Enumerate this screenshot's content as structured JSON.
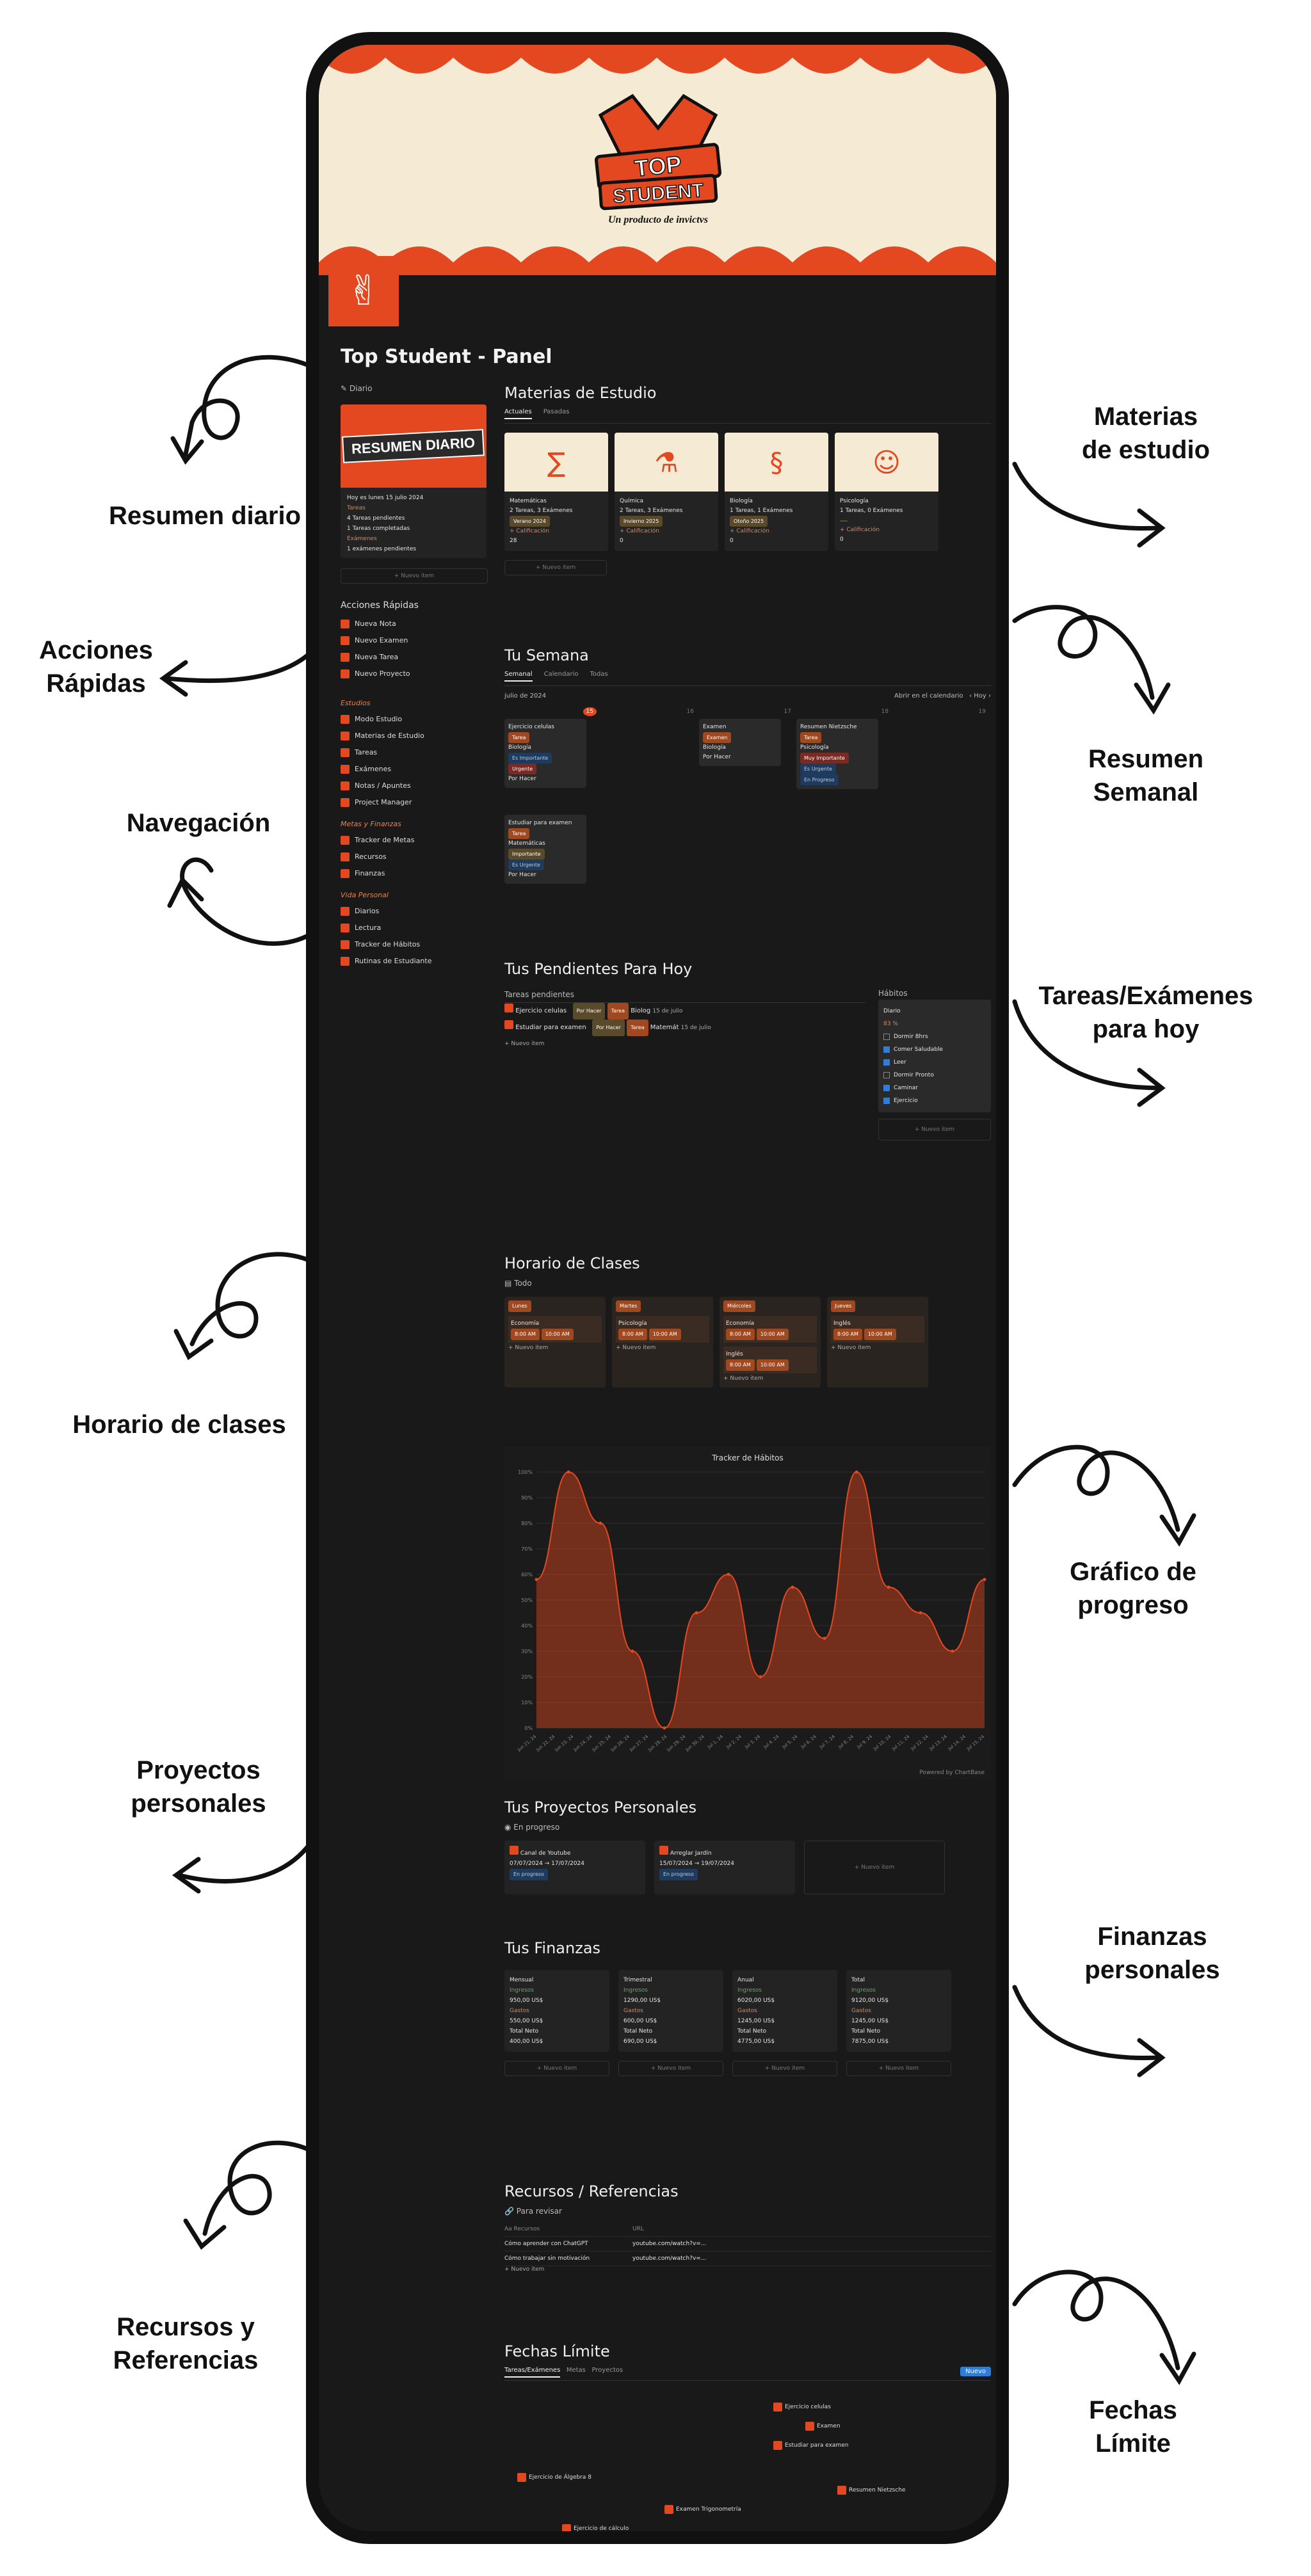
{
  "callouts": {
    "resumen_diario": "Resumen diario",
    "acciones_rapidas": "Acciones\nRápidas",
    "navegacion": "Navegación",
    "horario": "Horario de clases",
    "proyectos": "Proyectos\npersonales",
    "recursos": "Recursos y\nReferencias",
    "materias": "Materias\nde estudio",
    "resumen_semanal": "Resumen\nSemanal",
    "tareas_hoy": "Tareas/Exámenes\npara hoy",
    "grafico": "Gráfico de\nprogreso",
    "finanzas": "Finanzas\npersonales",
    "fechas": "Fechas\nLímite"
  },
  "banner": {
    "logo_top": "TOP",
    "logo_bottom": "STUDENT",
    "byline": "Un producto de invictvs"
  },
  "page": {
    "title": "Top Student - Panel"
  },
  "sidebar": {
    "diario_label": "Diario",
    "daily_card_title": "RESUMEN DIARIO",
    "daily_date": "Hoy es lunes 15 julio 2024",
    "tareas_lbl": "Tareas",
    "tareas_1": "4 Tareas pendientes",
    "tareas_2": "1 Tareas completadas",
    "examenes_lbl": "Exámenes",
    "examenes_1": "1 exámenes pendientes",
    "new_item": "+ Nuevo item",
    "acciones_title": "Acciones Rápidas",
    "acciones": [
      "Nueva Nota",
      "Nuevo Examen",
      "Nueva Tarea",
      "Nuevo Proyecto"
    ],
    "estudios_label": "Estudios",
    "estudios": [
      "Modo Estudio",
      "Materias de Estudio",
      "Tareas",
      "Exámenes",
      "Notas / Apuntes",
      "Project Manager"
    ],
    "metas_label": "Metas y Finanzas",
    "metas": [
      "Tracker de Metas",
      "Recursos",
      "Finanzas"
    ],
    "vida_label": "Vida Personal",
    "vida": [
      "Diarios",
      "Lectura",
      "Tracker de Hábitos",
      "Rutinas de Estudiante"
    ]
  },
  "materias": {
    "title": "Materias de Estudio",
    "tabs": [
      "Actuales",
      "Pasadas"
    ],
    "cards": [
      {
        "name": "Matemáticas",
        "meta": "2 Tareas, 3 Exámenes",
        "period": "Verano 2024",
        "calif": "+ Calificación",
        "score": "28"
      },
      {
        "name": "Química",
        "meta": "2 Tareas, 3 Exámenes",
        "period": "Invierno 2025",
        "calif": "+ Calificación",
        "score": "0"
      },
      {
        "name": "Biología",
        "meta": "1 Tareas, 1 Exámenes",
        "period": "Otoño 2025",
        "calif": "+ Calificación",
        "score": "0"
      },
      {
        "name": "Psicología",
        "meta": "1 Tareas, 0 Exámenes",
        "period": "",
        "calif": "+ Calificación",
        "score": "0"
      }
    ],
    "new_item": "+ Nuevo item"
  },
  "semana": {
    "title": "Tu Semana",
    "tabs": [
      "Semanal",
      "Calendario",
      "Todas"
    ],
    "month": "julio de 2024",
    "open_cal": "Abrir en el calendario",
    "today": "Hoy",
    "days": [
      "15",
      "16",
      "17",
      "18",
      "19"
    ],
    "events": [
      {
        "title": "Ejercicio celulas",
        "tags": [
          "Tarea",
          "Biología",
          "Es Importante",
          "Urgente",
          "Por Hacer"
        ]
      },
      {
        "title": "Estudiar para examen",
        "tags": [
          "Tarea",
          "Matemáticas",
          "Importante",
          "Es Urgente",
          "Por Hacer"
        ]
      },
      {
        "title": "Examen",
        "tags": [
          "Examen",
          "Biología",
          "Por Hacer"
        ]
      },
      {
        "title": "Resumen Nietzsche",
        "tags": [
          "Tarea",
          "Psicología",
          "Muy Importante",
          "Es Urgente",
          "En Progreso"
        ]
      }
    ]
  },
  "pendientes": {
    "title": "Tus Pendientes Para Hoy",
    "list_title": "Tareas pendientes",
    "items": [
      {
        "name": "Ejercicio celulas",
        "status": "Por Hacer",
        "type": "Tarea",
        "subject": "Biolog",
        "date": "15 de julio"
      },
      {
        "name": "Estudiar para examen",
        "status": "Por Hacer",
        "type": "Tarea",
        "subject": "Matemát",
        "date": "15 de julio"
      }
    ],
    "new_item": "+ Nuevo item",
    "habits_title": "Hábitos",
    "habits_heading": "Diario",
    "habits_pct": "83 %",
    "habits": [
      {
        "name": "Dormir 8hrs",
        "done": false
      },
      {
        "name": "Comer Saludable",
        "done": true
      },
      {
        "name": "Leer",
        "done": true
      },
      {
        "name": "Dormir Pronto",
        "done": false
      },
      {
        "name": "Caminar",
        "done": true
      },
      {
        "name": "Ejercicio",
        "done": true
      }
    ],
    "habits_new": "+ Nuevo item"
  },
  "horario": {
    "title": "Horario de Clases",
    "tab": "Todo",
    "days": [
      {
        "day": "Lunes",
        "classes": [
          {
            "name": "Economía",
            "t1": "8:00 AM",
            "t2": "10:00 AM"
          }
        ]
      },
      {
        "day": "Martes",
        "classes": [
          {
            "name": "Psicología",
            "t1": "8:00 AM",
            "t2": "10:00 AM"
          }
        ]
      },
      {
        "day": "Miércoles",
        "classes": [
          {
            "name": "Economía",
            "t1": "8:00 AM",
            "t2": "10:00 AM"
          },
          {
            "name": "Inglés",
            "t1": "8:00 AM",
            "t2": "10:00 AM"
          }
        ]
      },
      {
        "day": "Jueves",
        "classes": [
          {
            "name": "Inglés",
            "t1": "8:00 AM",
            "t2": "10:00 AM"
          }
        ]
      }
    ],
    "new_item": "+ Nuevo item"
  },
  "chart_data": {
    "type": "area",
    "title": "Tracker de Hábitos",
    "x": [
      "Jun 21, 24",
      "Jun 22, 24",
      "Jun 23, 24",
      "Jun 24, 24",
      "Jun 25, 24",
      "Jun 26, 24",
      "Jun 27, 24",
      "Jun 28, 24",
      "Jun 29, 24",
      "Jun 30, 24",
      "Jul 1, 24",
      "Jul 2, 24",
      "Jul 3, 24",
      "Jul 4, 24",
      "Jul 5, 24",
      "Jul 6, 24",
      "Jul 7, 24",
      "Jul 8, 24",
      "Jul 9, 24",
      "Jul 10, 24",
      "Jul 11, 24",
      "Jul 12, 24",
      "Jul 13, 24",
      "Jul 14, 24",
      "Jul 15, 24"
    ],
    "values": [
      58,
      100,
      80,
      30,
      0,
      45,
      60,
      20,
      55,
      35,
      100,
      55,
      45,
      30,
      58
    ],
    "ylim": [
      0,
      100
    ],
    "yticks": [
      "0%",
      "10%",
      "20%",
      "30%",
      "40%",
      "50%",
      "60%",
      "70%",
      "80%",
      "90%",
      "100%"
    ],
    "color": "#e34820",
    "footer": "Powered by ChartBase"
  },
  "proyectos": {
    "title": "Tus Proyectos Personales",
    "tab": "En progreso",
    "items": [
      {
        "name": "Canal de Youtube",
        "dates": "07/07/2024 → 17/07/2024",
        "status": "En progreso"
      },
      {
        "name": "Arreglar Jardín",
        "dates": "15/07/2024 → 19/07/2024",
        "status": "En progreso"
      }
    ],
    "new_item": "+ Nuevo item"
  },
  "finanzas": {
    "title": "Tus Finanzas",
    "cards": [
      {
        "name": "Mensual",
        "ing_lbl": "Ingresos",
        "ing": "950,00 US$",
        "gas_lbl": "Gastos",
        "gas": "550,00 US$",
        "net_lbl": "Total Neto",
        "net": "400,00 US$"
      },
      {
        "name": "Trimestral",
        "ing_lbl": "Ingresos",
        "ing": "1290,00 US$",
        "gas_lbl": "Gastos",
        "gas": "600,00 US$",
        "net_lbl": "Total Neto",
        "net": "690,00 US$"
      },
      {
        "name": "Anual",
        "ing_lbl": "Ingresos",
        "ing": "6020,00 US$",
        "gas_lbl": "Gastos",
        "gas": "1245,00 US$",
        "net_lbl": "Total Neto",
        "net": "4775,00 US$"
      },
      {
        "name": "Total",
        "ing_lbl": "Ingresos",
        "ing": "9120,00 US$",
        "gas_lbl": "Gastos",
        "gas": "1245,00 US$",
        "net_lbl": "Total Neto",
        "net": "7875,00 US$"
      }
    ],
    "new_item": "+ Nuevo item"
  },
  "recursos": {
    "title": "Recursos / Referencias",
    "tab": "Para revisar",
    "col1": "Aa Recursos",
    "col2": "URL",
    "rows": [
      {
        "name": "Cómo aprender con ChatGPT",
        "url": "youtube.com/watch?v=..."
      },
      {
        "name": "Cómo trabajar sin motivación",
        "url": "youtube.com/watch?v=..."
      }
    ],
    "new_item": "+ Nuevo item"
  },
  "fechas": {
    "title": "Fechas Límite",
    "tabs": [
      "Tareas/Exámenes",
      "Metas",
      "Proyectos"
    ],
    "new_btn": "Nuevo",
    "items": [
      "Ejercicio celulas",
      "Examen",
      "Estudiar para examen",
      "Ejercicio de Álgebra 8",
      "Resumen Nietzsche",
      "Examen Trigonometría",
      "Ejercicio de cálculo"
    ]
  }
}
